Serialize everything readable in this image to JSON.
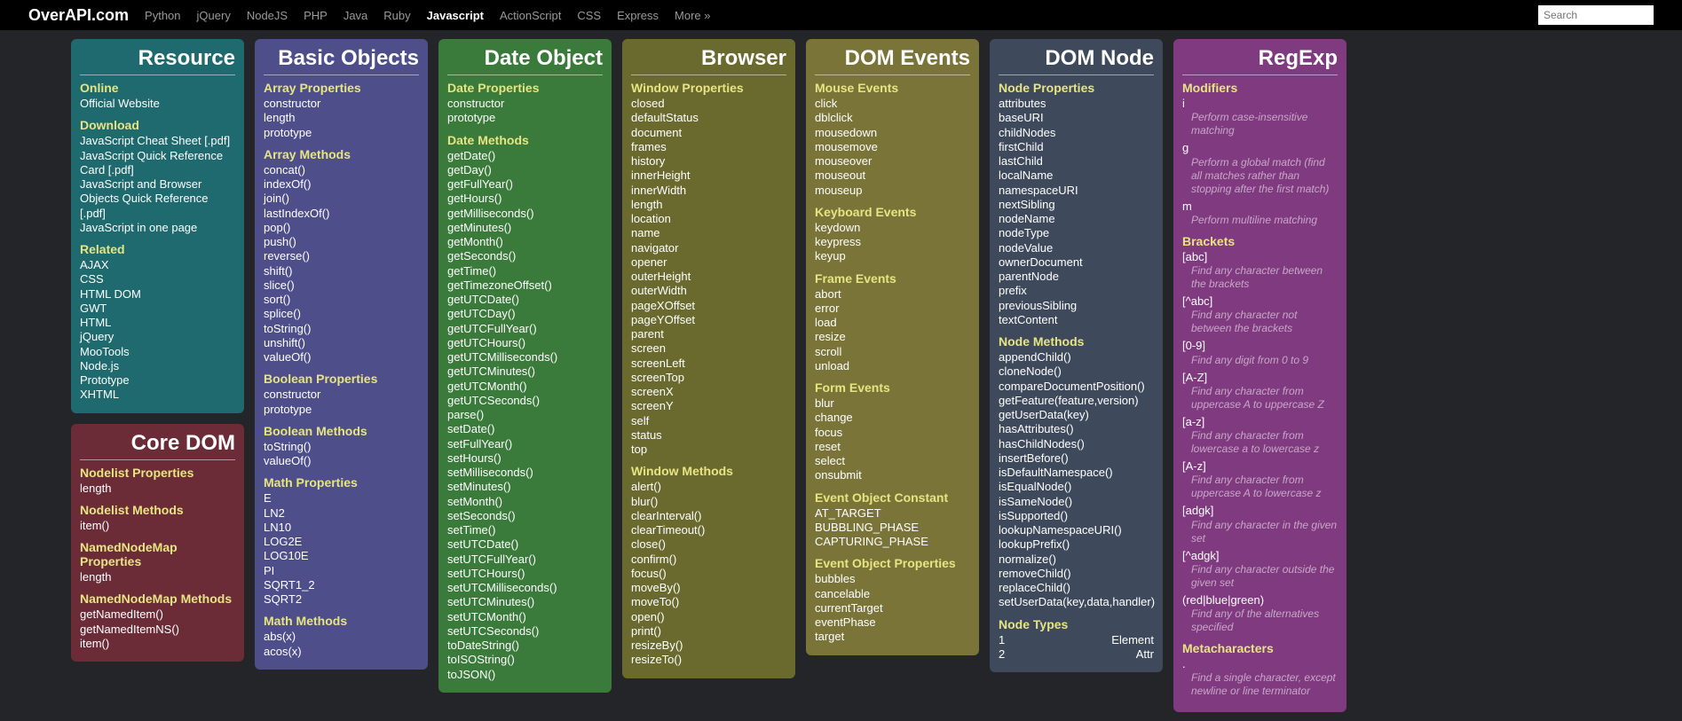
{
  "nav": {
    "brand": "OverAPI.com",
    "links": [
      "Python",
      "jQuery",
      "NodeJS",
      "PHP",
      "Java",
      "Ruby",
      "Javascript",
      "ActionScript",
      "CSS",
      "Express",
      "More »"
    ],
    "active": "Javascript",
    "search_placeholder": "Search"
  },
  "columns": [
    {
      "cards": [
        {
          "title": "Resource",
          "color": "c-teal",
          "sections": [
            {
              "title": "Online",
              "items": [
                "Official Website"
              ]
            },
            {
              "title": "Download",
              "items": [
                "JavaScript Cheat Sheet [.pdf]",
                "JavaScript Quick Reference Card [.pdf]",
                "JavaScript and Browser Objects Quick Reference [.pdf]",
                "JavaScript in one page"
              ]
            },
            {
              "title": "Related",
              "items": [
                "AJAX",
                "CSS",
                "HTML DOM",
                "GWT",
                "HTML",
                "jQuery",
                "MooTools",
                "Node.js",
                "Prototype",
                "XHTML"
              ]
            }
          ]
        },
        {
          "title": "Core DOM",
          "color": "c-red",
          "sections": [
            {
              "title": "Nodelist Properties",
              "items": [
                "length"
              ]
            },
            {
              "title": "Nodelist Methods",
              "items": [
                "item()"
              ]
            },
            {
              "title": "NamedNodeMap Properties",
              "items": [
                "length"
              ]
            },
            {
              "title": "NamedNodeMap Methods",
              "items": [
                "getNamedItem()",
                "getNamedItemNS()",
                "item()"
              ]
            }
          ]
        }
      ]
    },
    {
      "cards": [
        {
          "title": "Basic Objects",
          "color": "c-purple",
          "sections": [
            {
              "title": "Array Properties",
              "items": [
                "constructor",
                "length",
                "prototype"
              ]
            },
            {
              "title": "Array Methods",
              "items": [
                "concat()",
                "indexOf()",
                "join()",
                "lastIndexOf()",
                "pop()",
                "push()",
                "reverse()",
                "shift()",
                "slice()",
                "sort()",
                "splice()",
                "toString()",
                "unshift()",
                "valueOf()"
              ]
            },
            {
              "title": "Boolean Properties",
              "items": [
                "constructor",
                "prototype"
              ]
            },
            {
              "title": "Boolean Methods",
              "items": [
                "toString()",
                "valueOf()"
              ]
            },
            {
              "title": "Math Properties",
              "items": [
                "E",
                "LN2",
                "LN10",
                "LOG2E",
                "LOG10E",
                "PI",
                "SQRT1_2",
                "SQRT2"
              ]
            },
            {
              "title": "Math Methods",
              "items": [
                "abs(x)",
                "acos(x)"
              ]
            }
          ]
        }
      ]
    },
    {
      "cards": [
        {
          "title": "Date Object",
          "color": "c-green",
          "sections": [
            {
              "title": "Date Properties",
              "items": [
                "constructor",
                "prototype"
              ]
            },
            {
              "title": "Date Methods",
              "items": [
                "getDate()",
                "getDay()",
                "getFullYear()",
                "getHours()",
                "getMilliseconds()",
                "getMinutes()",
                "getMonth()",
                "getSeconds()",
                "getTime()",
                "getTimezoneOffset()",
                "getUTCDate()",
                "getUTCDay()",
                "getUTCFullYear()",
                "getUTCHours()",
                "getUTCMilliseconds()",
                "getUTCMinutes()",
                "getUTCMonth()",
                "getUTCSeconds()",
                "parse()",
                "setDate()",
                "setFullYear()",
                "setHours()",
                "setMilliseconds()",
                "setMinutes()",
                "setMonth()",
                "setSeconds()",
                "setTime()",
                "setUTCDate()",
                "setUTCFullYear()",
                "setUTCHours()",
                "setUTCMilliseconds()",
                "setUTCMinutes()",
                "setUTCMonth()",
                "setUTCSeconds()",
                "toDateString()",
                "toISOString()",
                "toJSON()"
              ]
            }
          ]
        }
      ]
    },
    {
      "cards": [
        {
          "title": "Browser",
          "color": "c-olive",
          "sections": [
            {
              "title": "Window Properties",
              "items": [
                "closed",
                "defaultStatus",
                "document",
                "frames",
                "history",
                "innerHeight",
                "innerWidth",
                "length",
                "location",
                "name",
                "navigator",
                "opener",
                "outerHeight",
                "outerWidth",
                "pageXOffset",
                "pageYOffset",
                "parent",
                "screen",
                "screenLeft",
                "screenTop",
                "screenX",
                "screenY",
                "self",
                "status",
                "top"
              ]
            },
            {
              "title": "Window Methods",
              "items": [
                "alert()",
                "blur()",
                "clearInterval()",
                "clearTimeout()",
                "close()",
                "confirm()",
                "focus()",
                "moveBy()",
                "moveTo()",
                "open()",
                "print()",
                "resizeBy()",
                "resizeTo()"
              ]
            }
          ]
        }
      ]
    },
    {
      "cards": [
        {
          "title": "DOM Events",
          "color": "c-olive2",
          "sections": [
            {
              "title": "Mouse Events",
              "items": [
                "click",
                "dblclick",
                "mousedown",
                "mousemove",
                "mouseover",
                "mouseout",
                "mouseup"
              ]
            },
            {
              "title": "Keyboard Events",
              "items": [
                "keydown",
                "keypress",
                "keyup"
              ]
            },
            {
              "title": "Frame Events",
              "items": [
                "abort",
                "error",
                "load",
                "resize",
                "scroll",
                "unload"
              ]
            },
            {
              "title": "Form Events",
              "items": [
                "blur",
                "change",
                "focus",
                "reset",
                "select",
                "onsubmit"
              ]
            },
            {
              "title": "Event Object Constant",
              "items": [
                "AT_TARGET",
                "BUBBLING_PHASE",
                "CAPTURING_PHASE"
              ]
            },
            {
              "title": "Event Object Properties",
              "items": [
                "bubbles",
                "cancelable",
                "currentTarget",
                "eventPhase",
                "target"
              ]
            }
          ]
        }
      ]
    },
    {
      "cards": [
        {
          "title": "DOM Node",
          "color": "c-slate",
          "sections": [
            {
              "title": "Node Properties",
              "items": [
                "attributes",
                "baseURI",
                "childNodes",
                "firstChild",
                "lastChild",
                "localName",
                "namespaceURI",
                "nextSibling",
                "nodeName",
                "nodeType",
                "nodeValue",
                "ownerDocument",
                "parentNode",
                "prefix",
                "previousSibling",
                "textContent"
              ]
            },
            {
              "title": "Node Methods",
              "items": [
                "appendChild()",
                "cloneNode()",
                "compareDocumentPosition()",
                "getFeature(feature,version)",
                "getUserData(key)",
                "hasAttributes()",
                "hasChildNodes()",
                "insertBefore()",
                "isDefaultNamespace()",
                "isEqualNode()",
                "isSameNode()",
                "isSupported()",
                "lookupNamespaceURI()",
                "lookupPrefix()",
                "normalize()",
                "removeChild()",
                "replaceChild()",
                "setUserData(key,data,handler)"
              ]
            },
            {
              "title": "Node Types",
              "rows": [
                [
                  "1",
                  "Element"
                ],
                [
                  "2",
                  "Attr"
                ]
              ]
            }
          ]
        }
      ]
    },
    {
      "cards": [
        {
          "title": "RegExp",
          "color": "c-magenta",
          "sections": [
            {
              "title": "Modifiers",
              "descitems": [
                {
                  "label": "i",
                  "desc": "Perform case-insensitive matching"
                },
                {
                  "label": "g",
                  "desc": "Perform a global match (find all matches rather than stopping after the first match)"
                },
                {
                  "label": "m",
                  "desc": "Perform multiline matching"
                }
              ]
            },
            {
              "title": "Brackets",
              "descitems": [
                {
                  "label": "[abc]",
                  "desc": "Find any character between the brackets"
                },
                {
                  "label": "[^abc]",
                  "desc": "Find any character not between the brackets"
                },
                {
                  "label": "[0-9]",
                  "desc": "Find any digit from 0 to 9"
                },
                {
                  "label": "[A-Z]",
                  "desc": "Find any character from uppercase A to uppercase Z"
                },
                {
                  "label": "[a-z]",
                  "desc": "Find any character from lowercase a to lowercase z"
                },
                {
                  "label": "[A-z]",
                  "desc": "Find any character from uppercase A to lowercase z"
                },
                {
                  "label": "[adgk]",
                  "desc": "Find any character in the given set"
                },
                {
                  "label": "[^adgk]",
                  "desc": "Find any character outside the given set"
                },
                {
                  "label": "(red|blue|green)",
                  "desc": "Find any of the alternatives specified"
                }
              ]
            },
            {
              "title": "Metacharacters",
              "descitems": [
                {
                  "label": ".",
                  "desc": "Find a single character, except newline or line terminator"
                }
              ]
            }
          ]
        }
      ]
    }
  ]
}
